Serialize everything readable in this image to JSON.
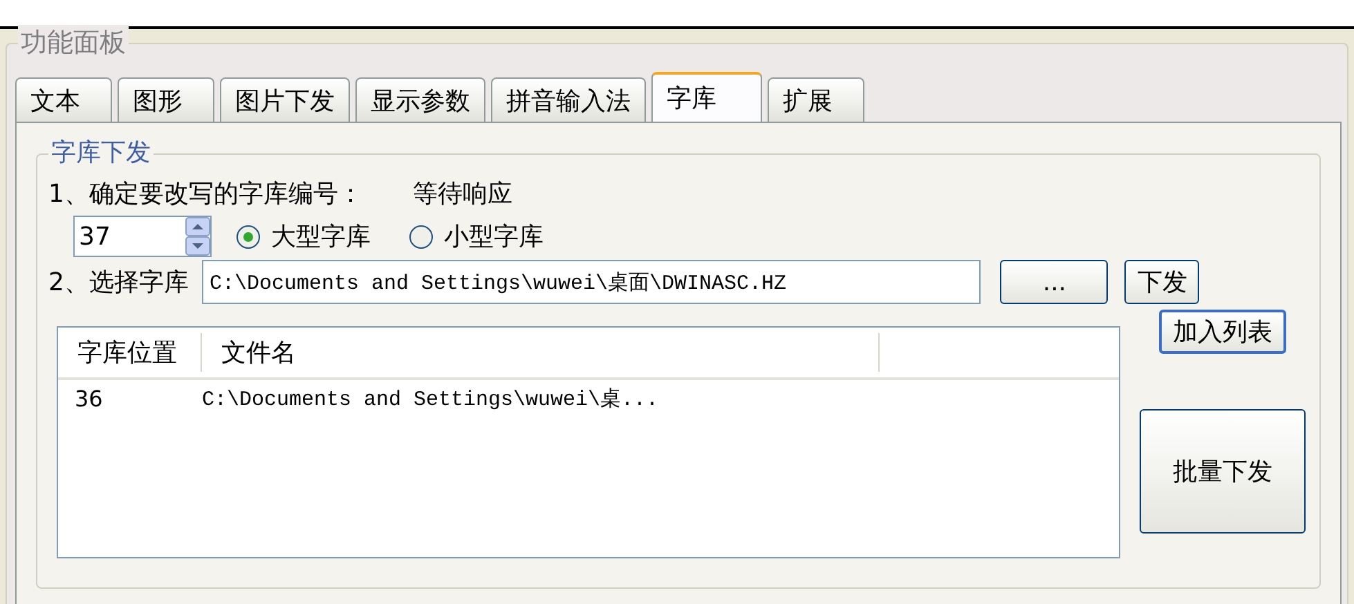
{
  "panel": {
    "title": "功能面板"
  },
  "tabs": [
    {
      "label": "文本",
      "selected": false
    },
    {
      "label": "图形",
      "selected": false
    },
    {
      "label": "图片下发",
      "selected": false
    },
    {
      "label": "显示参数",
      "selected": false
    },
    {
      "label": "拼音输入法",
      "selected": false
    },
    {
      "label": "字库",
      "selected": true
    },
    {
      "label": "扩展",
      "selected": false
    }
  ],
  "group": {
    "title": "字库下发"
  },
  "step1": {
    "label": "1、确定要改写的字库编号：",
    "status": "等待响应"
  },
  "number_field": {
    "value": "37"
  },
  "radios": [
    {
      "label": "大型字库",
      "selected": true
    },
    {
      "label": "小型字库",
      "selected": false
    }
  ],
  "step2": {
    "label": "2、选择字库",
    "value": "C:\\Documents and Settings\\wuwei\\桌面\\DWINASC.HZ"
  },
  "buttons": {
    "browse": "...",
    "send": "下发",
    "add": "加入列表",
    "batch": "批量下发"
  },
  "table": {
    "columns": [
      "字库位置",
      "文件名"
    ],
    "rows": [
      [
        "36",
        "C:\\Documents and Settings\\wuwei\\桌..."
      ]
    ]
  }
}
